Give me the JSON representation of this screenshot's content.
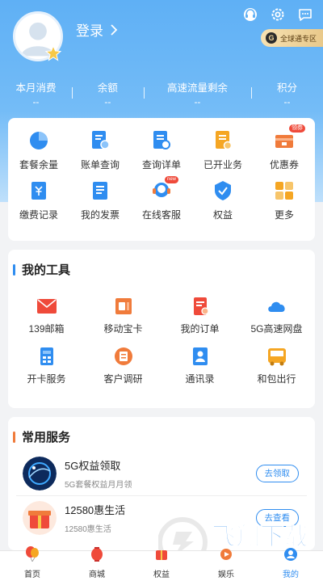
{
  "header": {
    "login_label": "登录",
    "zone_badge": "全球通专区",
    "zone_badge_letter": "G"
  },
  "stats": [
    {
      "label": "本月消费",
      "value": "--"
    },
    {
      "label": "余额",
      "value": "--"
    },
    {
      "label": "高速流量剩余",
      "value": "--"
    },
    {
      "label": "积分",
      "value": "--"
    }
  ],
  "quick": [
    {
      "label": "套餐余量",
      "icon": "pie-chart-icon"
    },
    {
      "label": "账单查询",
      "icon": "bill-search-icon"
    },
    {
      "label": "查询详单",
      "icon": "detail-search-icon"
    },
    {
      "label": "已开业务",
      "icon": "business-icon"
    },
    {
      "label": "优惠券",
      "icon": "coupon-icon",
      "tag": "领券"
    },
    {
      "label": "缴费记录",
      "icon": "payment-record-icon"
    },
    {
      "label": "我的发票",
      "icon": "invoice-icon"
    },
    {
      "label": "在线客服",
      "icon": "customer-service-icon",
      "tag": "new"
    },
    {
      "label": "权益",
      "icon": "rights-badge-icon"
    },
    {
      "label": "更多",
      "icon": "more-grid-icon"
    }
  ],
  "tools": {
    "title": "我的工具",
    "items": [
      {
        "label": "139邮箱",
        "icon": "mail-icon"
      },
      {
        "label": "移动宝卡",
        "icon": "sim-card-icon"
      },
      {
        "label": "我的订单",
        "icon": "order-icon"
      },
      {
        "label": "5G高速网盘",
        "icon": "cloud-icon"
      },
      {
        "label": "开卡服务",
        "icon": "open-card-icon"
      },
      {
        "label": "客户调研",
        "icon": "survey-icon"
      },
      {
        "label": "通讯录",
        "icon": "contacts-icon"
      },
      {
        "label": "和包出行",
        "icon": "bus-icon"
      }
    ]
  },
  "services": {
    "title": "常用服务",
    "items": [
      {
        "title": "5G权益领取",
        "subtitle": "5G套餐权益月月领",
        "button": "去领取"
      },
      {
        "title": "12580惠生活",
        "subtitle": "12580惠生活",
        "button": "去查看"
      }
    ]
  },
  "tabs": [
    {
      "label": "首页",
      "icon": "home-balloon-icon"
    },
    {
      "label": "商城",
      "icon": "lantern-icon"
    },
    {
      "label": "权益",
      "icon": "rights-tab-icon"
    },
    {
      "label": "娱乐",
      "icon": "entertainment-icon"
    },
    {
      "label": "我的",
      "icon": "me-icon",
      "active": true
    }
  ],
  "colors": {
    "header_top": "#5fb0f5",
    "accent_blue": "#2f8df0",
    "accent_orange": "#f07b3b"
  },
  "watermark": {
    "text": "飞翔下载",
    "url": "WWW.FXXZ.COM"
  }
}
